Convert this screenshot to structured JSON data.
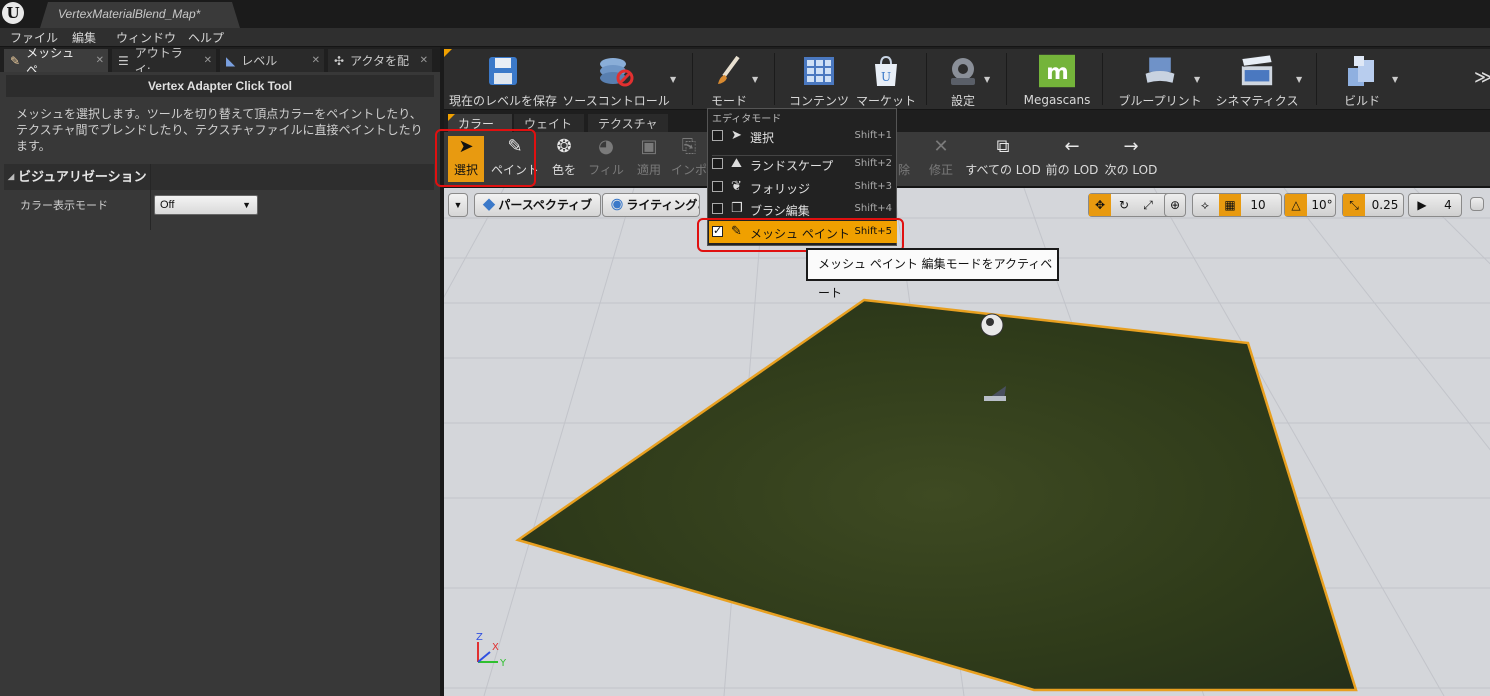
{
  "window": {
    "doc_tab": "VertexMaterialBlend_Map*"
  },
  "menu": [
    "ファイル",
    "編集",
    "ウィンドウ",
    "ヘルプ"
  ],
  "left_tabs": [
    {
      "label": "メッシュ ペ",
      "icon": "paint-brush-icon"
    },
    {
      "label": "アウトライ:",
      "icon": "outliner-icon"
    },
    {
      "label": "レベル",
      "icon": "levels-icon"
    },
    {
      "label": "アクタを配",
      "icon": "place-actors-icon"
    }
  ],
  "left_panel": {
    "tool_title": "Vertex Adapter Click Tool",
    "description": "メッシュを選択します。ツールを切り替えて頂点カラーをペイントしたり、テクスチャ間でブレンドしたり、テクスチャファイルに直接ペイントしたります。",
    "category": "ビジュアリゼーション",
    "property_label": "カラー表示モード",
    "property_value": "Off"
  },
  "main_toolbar": {
    "save": "現在のレベルを保存",
    "source_control": "ソースコントロール",
    "modes": "モード",
    "content": "コンテンツ",
    "marketplace": "マーケット",
    "settings": "設定",
    "megascans": "Megascans",
    "blueprints": "ブループリント",
    "cinematics": "シネマティクス",
    "build": "ビルド"
  },
  "mode_tabs": [
    "カラー",
    "ウェイト",
    "テクスチャ"
  ],
  "mode_toolbar": {
    "select": "選択",
    "paint": "ペイント",
    "color": "色を",
    "fill": "フィル",
    "apply": "適用",
    "import": "インポ",
    "remove": "除",
    "fix": "修正",
    "all_lod": "すべての LOD",
    "prev_lod": "前の LOD",
    "next_lod": "次の LOD"
  },
  "viewport": {
    "perspective": "パースペクティブ",
    "lighting": "ライティングあ",
    "grid_snap": "10",
    "rot_snap": "10°",
    "scale_snap": "0.25",
    "cam_speed": "4",
    "colors": {
      "floor_edge": "#e8a020",
      "accent": "#e89a10"
    }
  },
  "dropdown": {
    "header": "エディタモード",
    "items": [
      {
        "label": "選択",
        "shortcut": "Shift+1",
        "icon": "select-arrow-icon",
        "checked": false
      },
      {
        "label": "ランドスケープ",
        "shortcut": "Shift+2",
        "icon": "landscape-icon",
        "checked": false
      },
      {
        "label": "フォリッジ",
        "shortcut": "Shift+3",
        "icon": "foliage-icon",
        "checked": false
      },
      {
        "label": "ブラシ編集",
        "shortcut": "Shift+4",
        "icon": "brush-edit-icon",
        "checked": false
      },
      {
        "label": "メッシュ ペイント",
        "shortcut": "Shift+5",
        "icon": "mesh-paint-icon",
        "checked": true
      }
    ]
  },
  "tooltip": "メッシュ ペイント 編集モードをアクティベート"
}
